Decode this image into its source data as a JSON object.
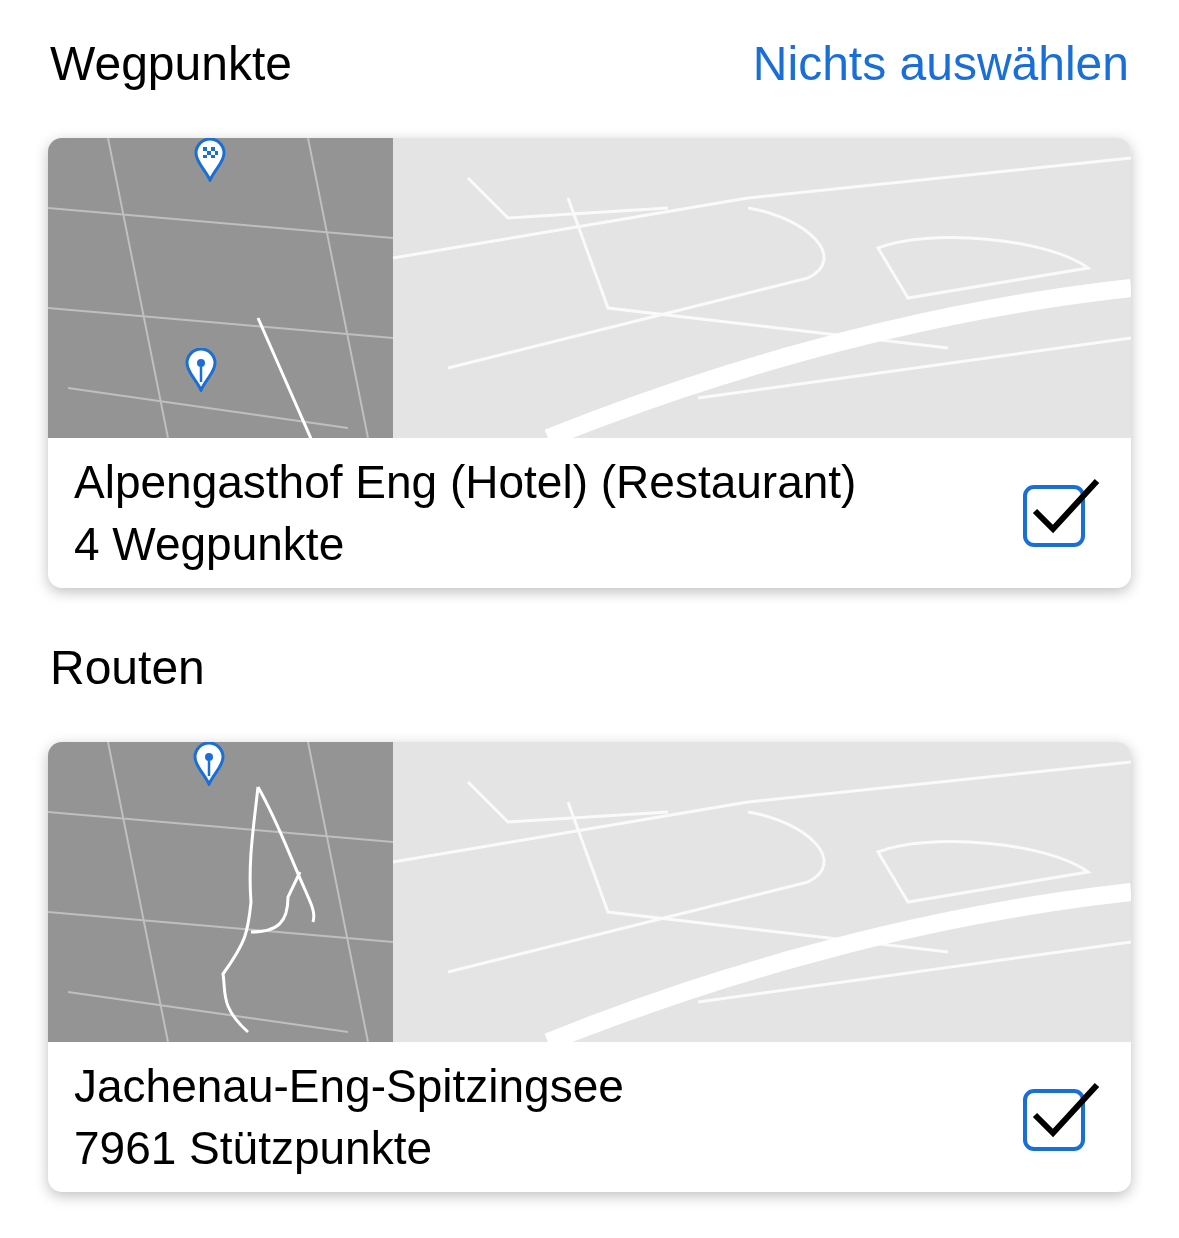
{
  "sections": [
    {
      "title": "Wegpunkte",
      "action": "Nichts auswählen",
      "items": [
        {
          "kind": "waypoints",
          "name": "Alpengasthof Eng (Hotel) (Restaurant)",
          "detail": "4 Wegpunkte",
          "checked": true
        }
      ]
    },
    {
      "title": "Routen",
      "items": [
        {
          "kind": "route",
          "name": "Jachenau-Eng-Spitzingsee",
          "detail": "7961 Stützpunkte",
          "checked": true
        }
      ]
    }
  ]
}
